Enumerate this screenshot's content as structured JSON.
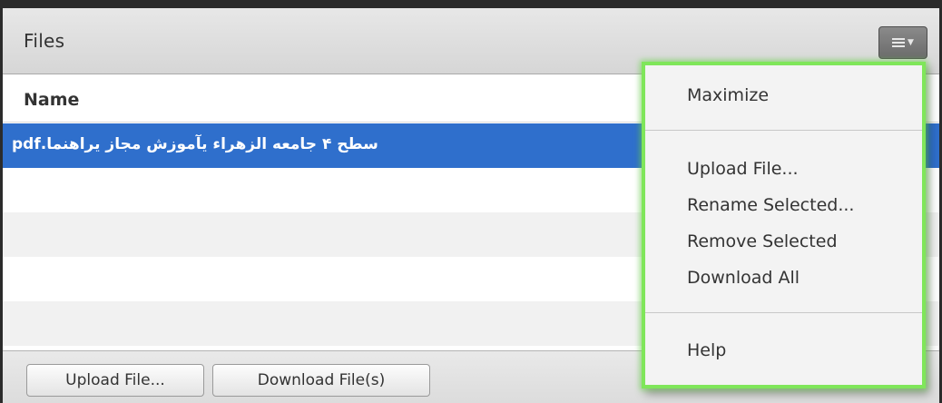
{
  "panel": {
    "title": "Files",
    "menu_button_icon": "menu-icon"
  },
  "table": {
    "column_name": "Name",
    "rows": [
      {
        "name": "سطح ۴ جامعه الزهراء یآموزش مجاز یراهنما.pdf",
        "selected": true
      }
    ]
  },
  "footer": {
    "upload_label": "Upload File...",
    "download_label": "Download File(s)"
  },
  "menu": {
    "maximize": "Maximize",
    "upload_file": "Upload File...",
    "rename_selected": "Rename Selected...",
    "remove_selected": "Remove Selected",
    "download_all": "Download All",
    "help": "Help"
  },
  "colors": {
    "selection": "#2f6fcc",
    "menu_highlight_border": "#7fe65a"
  }
}
